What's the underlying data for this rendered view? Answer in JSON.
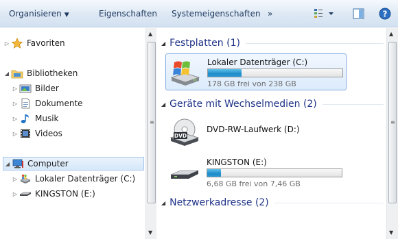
{
  "toolbar": {
    "organize": "Organisieren",
    "properties": "Eigenschaften",
    "system_properties": "Systemeigenschaften",
    "more": "»"
  },
  "nav": {
    "favorites": "Favoriten",
    "libraries": "Bibliotheken",
    "library_items": [
      {
        "label": "Bilder",
        "icon": "pictures-icon"
      },
      {
        "label": "Dokumente",
        "icon": "documents-icon"
      },
      {
        "label": "Musik",
        "icon": "music-icon"
      },
      {
        "label": "Videos",
        "icon": "videos-icon"
      }
    ],
    "computer": "Computer",
    "computer_items": [
      {
        "label": "Lokaler Datenträger (C:)",
        "icon": "local-disk-icon"
      },
      {
        "label": "KINGSTON (E:)",
        "icon": "usb-drive-icon"
      }
    ]
  },
  "groups": {
    "hard_disks": "Festplatten (1)",
    "removable": "Geräte mit Wechselmedien (2)",
    "network": "Netzwerkadresse (2)"
  },
  "drives": {
    "c": {
      "name": "Lokaler Datenträger (C:)",
      "free_text": "178 GB frei von 238 GB",
      "used_fraction": 0.25
    },
    "dvd": {
      "name": "DVD-RW-Laufwerk (D:)",
      "badge": "DVD"
    },
    "e": {
      "name": "KINGSTON (E:)",
      "free_text": "6,68 GB frei von 7,46 GB",
      "used_fraction": 0.1
    }
  },
  "colors": {
    "group_header": "#1e3287",
    "bar_fill": "#1f8cc8",
    "selection_border": "#84acdd"
  }
}
